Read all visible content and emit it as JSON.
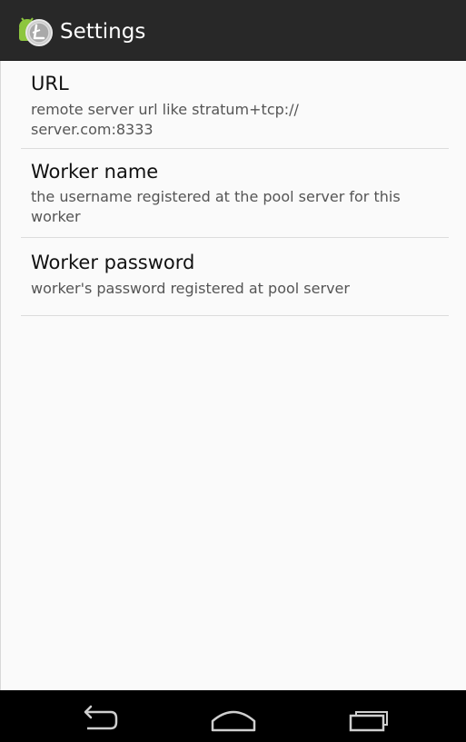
{
  "action_bar": {
    "title": "Settings"
  },
  "preferences": [
    {
      "title": "URL",
      "summary": "remote server url like stratum+tcp:// server.com:8333"
    },
    {
      "title": "Worker name",
      "summary": "the username registered at the pool server for this worker"
    },
    {
      "title": "Worker password",
      "summary": "worker's password registered at pool server"
    }
  ],
  "navigation": {
    "buttons": [
      "back-icon",
      "home-icon",
      "recent-apps-icon"
    ]
  },
  "colors": {
    "action_bar": "#282828",
    "background": "#fafafa",
    "android_green": "#8dc63f",
    "nav_bar": "#000000"
  }
}
